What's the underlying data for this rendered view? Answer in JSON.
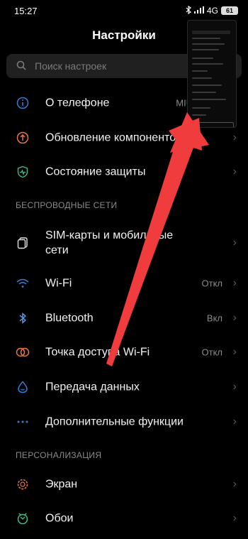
{
  "status": {
    "time": "15:27",
    "network": "4G",
    "battery": "61"
  },
  "header": {
    "title": "Настройки"
  },
  "search": {
    "placeholder": "Поиск настроек"
  },
  "items_top": [
    {
      "label": "О телефоне",
      "value": "MIUI Globa",
      "icon": "info-icon"
    },
    {
      "label": "Обновление компоненто",
      "value": "",
      "icon": "upload-icon"
    },
    {
      "label": "Состояние защиты",
      "value": "",
      "icon": "shield-icon"
    }
  ],
  "section_wireless": "БЕСПРОВОДНЫЕ СЕТИ",
  "items_wireless": [
    {
      "label": "SIM-карты и мобильные сети",
      "value": "",
      "icon": "sim-icon"
    },
    {
      "label": "Wi-Fi",
      "value": "Откл",
      "icon": "wifi-icon"
    },
    {
      "label": "Bluetooth",
      "value": "Вкл",
      "icon": "bluetooth-icon"
    },
    {
      "label": "Точка доступа Wi-Fi",
      "value": "Откл",
      "icon": "hotspot-icon"
    },
    {
      "label": "Передача данных",
      "value": "",
      "icon": "data-usage-icon"
    },
    {
      "label": "Дополнительные функции",
      "value": "",
      "icon": "more-icon"
    }
  ],
  "section_personal": "ПЕРСОНАЛИЗАЦИЯ",
  "items_personal": [
    {
      "label": "Экран",
      "value": "",
      "icon": "brightness-icon"
    },
    {
      "label": "Обои",
      "value": "",
      "icon": "wallpaper-icon"
    }
  ],
  "colors": {
    "accent": "#2f7fd8",
    "arrow": "#f03c3c",
    "background": "#000000"
  }
}
